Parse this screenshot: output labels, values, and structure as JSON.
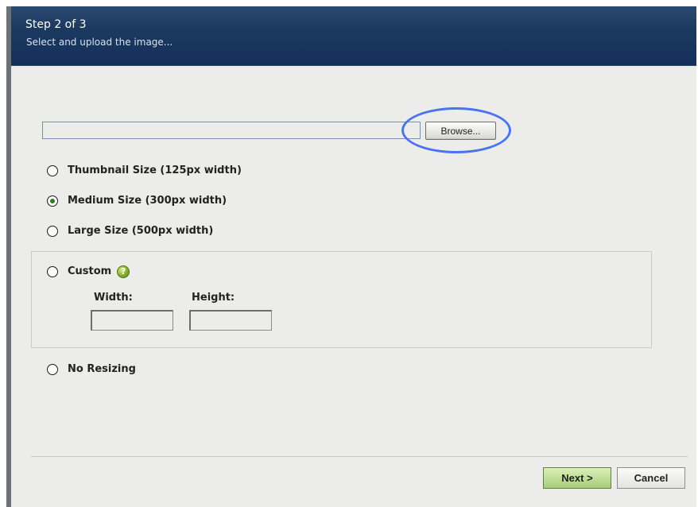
{
  "header": {
    "title": "Step 2 of 3",
    "subtitle": "Select and upload the image..."
  },
  "upload": {
    "file_value": "",
    "browse_label": "Browse..."
  },
  "options": [
    {
      "label": "Thumbnail Size (125px width)",
      "checked": false
    },
    {
      "label": "Medium Size (300px width)",
      "checked": true
    },
    {
      "label": "Large Size (500px width)",
      "checked": false
    }
  ],
  "custom": {
    "label": "Custom",
    "help_icon": "question-help-icon",
    "width_label": "Width:",
    "height_label": "Height:",
    "width_value": "",
    "height_value": ""
  },
  "no_resizing": {
    "label": "No Resizing",
    "checked": false
  },
  "footer": {
    "next_label": "Next >",
    "cancel_label": "Cancel"
  },
  "colors": {
    "header_background": "#1c3960",
    "dialog_background": "#ececea",
    "highlight": "#4a74ef",
    "primary_button": "#a8ce78",
    "radio_checked": "#2e7a2a"
  }
}
